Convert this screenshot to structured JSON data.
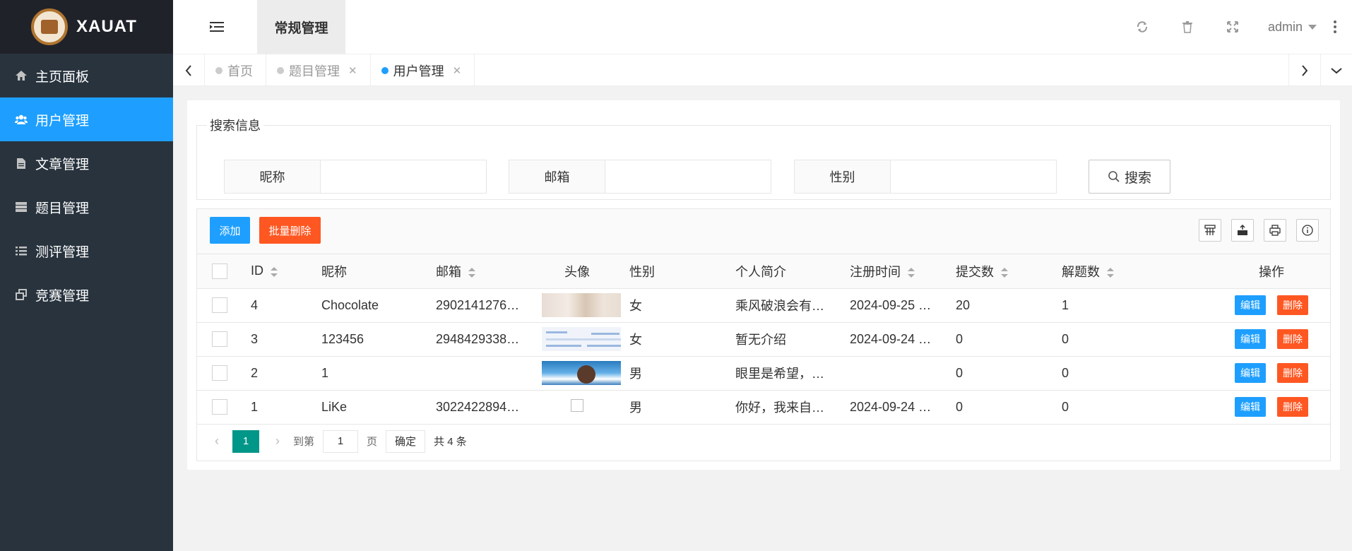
{
  "brand": {
    "name": "XAUAT"
  },
  "sidebar": {
    "items": [
      {
        "label": "主页面板",
        "icon": "home-icon"
      },
      {
        "label": "用户管理",
        "icon": "users-icon",
        "active": true
      },
      {
        "label": "文章管理",
        "icon": "file-icon"
      },
      {
        "label": "题目管理",
        "icon": "server-icon"
      },
      {
        "label": "测评管理",
        "icon": "list-icon"
      },
      {
        "label": "竞赛管理",
        "icon": "clone-icon"
      }
    ]
  },
  "header": {
    "active_tab": "常规管理",
    "user": "admin",
    "icons": [
      "refresh-icon",
      "trash-icon",
      "fullscreen-icon",
      "more-icon"
    ]
  },
  "tabs": [
    {
      "label": "首页",
      "closable": false
    },
    {
      "label": "题目管理",
      "closable": true
    },
    {
      "label": "用户管理",
      "closable": true,
      "active": true
    }
  ],
  "search": {
    "legend": "搜索信息",
    "fields": [
      {
        "label": "昵称",
        "value": ""
      },
      {
        "label": "邮箱",
        "value": ""
      },
      {
        "label": "性别",
        "value": ""
      }
    ],
    "button": "搜索"
  },
  "toolbar": {
    "add": "添加",
    "batch_delete": "批量删除",
    "tools": [
      "columns-icon",
      "export-icon",
      "print-icon",
      "info-icon"
    ]
  },
  "table": {
    "headers": [
      "ID",
      "昵称",
      "邮箱",
      "头像",
      "性别",
      "个人简介",
      "注册时间",
      "提交数",
      "解题数",
      "操作"
    ],
    "rows": [
      {
        "id": "4",
        "nickname": "Chocolate",
        "email": "2902141276…",
        "avatar": "photo-avatar",
        "gender": "女",
        "bio": "乘风破浪会有…",
        "registered": "2024-09-25 …",
        "submissions": "20",
        "solved": "1"
      },
      {
        "id": "3",
        "nickname": "123456",
        "email": "2948429338…",
        "avatar": "screenshot-avatar",
        "gender": "女",
        "bio": "暂无介绍",
        "registered": "2024-09-24 …",
        "submissions": "0",
        "solved": "0"
      },
      {
        "id": "2",
        "nickname": "1",
        "email": "",
        "avatar": "anime-avatar",
        "gender": "男",
        "bio": "眼里是希望，…",
        "registered": "",
        "submissions": "0",
        "solved": "0"
      },
      {
        "id": "1",
        "nickname": "LiKe",
        "email": "3022422894…",
        "avatar": "broken-image",
        "gender": "男",
        "bio": "你好，我来自…",
        "registered": "2024-09-24 …",
        "submissions": "0",
        "solved": "0"
      }
    ],
    "edit_label": "编辑",
    "delete_label": "删除"
  },
  "pager": {
    "current": "1",
    "goto_label": "到第",
    "goto_value": "1",
    "page_label": "页",
    "confirm": "确定",
    "total": "共 4 条"
  },
  "colors": {
    "sidebar": "#28333e",
    "accent": "#1e9fff",
    "danger": "#ff5722",
    "pager": "#009688"
  }
}
